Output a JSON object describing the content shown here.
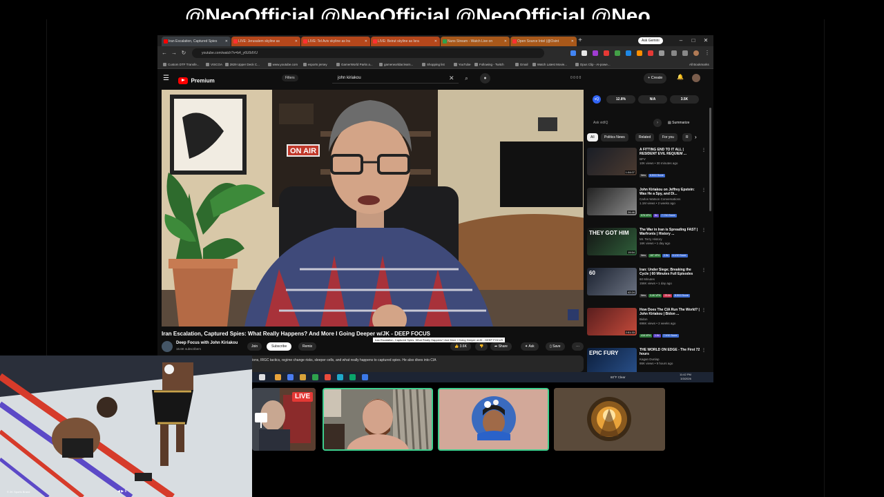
{
  "overlay": {
    "banner_text": "@NeoOfficial @NeoOfficial @NeoOfficial @Neo"
  },
  "browser": {
    "tabs": [
      {
        "label": "Iran Escalation, Captured Spies",
        "color": "#3b3f44",
        "active": true
      },
      {
        "label": "LIVE: Jerusalem skyline as",
        "color": "#b5471b"
      },
      {
        "label": "LIVE: Tel Aviv skyline as Ira",
        "color": "#b5471b"
      },
      {
        "label": "LIVE: Beirut skyline as Isra",
        "color": "#b5471b"
      },
      {
        "label": "Nuns Stream - Watch Live on",
        "color": "#a8581a"
      },
      {
        "label": "Open Source Intel (@Osint",
        "color": "#a8581a"
      }
    ],
    "new_tab": "+",
    "ask_gemini": "Ask Gemini",
    "window_controls": [
      "–",
      "□",
      "✕"
    ],
    "url": "youtube.com/watch?v=b4_y6U0dVU",
    "bookmarks": [
      "Custom DTF Transfe...",
      "VISCOA",
      "2829 Upper Deck C...",
      "www.youtube.com",
      "esports jersey",
      "GamerWorld Parks a...",
      "gamerworldar.learn...",
      "Shopping list",
      "YouTube",
      "Following - Twitch",
      "Gmail",
      "Watch Latest Movie...",
      "Opus Clip - AI-powe..."
    ],
    "all_bookmarks": "All Bookmarks"
  },
  "youtube": {
    "logo_word": "Premium",
    "filters": "Filters",
    "search_query": "john kiriakou",
    "header_stats": "0  0  0  0",
    "create": "+ Create",
    "video": {
      "on_air_sign": "ON AIR",
      "title": "Iran Escalation, Captured Spies: What Really Happens? And More I Going Deeper w/JK - DEEP FOCUS",
      "channel": "Deep Focus with John Kiriakou",
      "subscribers": "16.6K subscribers",
      "join": "Join",
      "subscribe": "Subscribe",
      "remix": "Remix",
      "tooltip": "Iran Escalation, Captured Spies: What Really Happens? And More I Going Deeper w/JK - DEEP FOCUS",
      "likes": "3.6K",
      "share": "Share",
      "ask": "Ask",
      "save": "Save",
      "more": "···",
      "description": "answers your top questions on escalating U.S.–Iran tensions, IRGC tactics, regime change risks, sleeper cells, and what really happens to captured spies. He also dives into CIA"
    },
    "sidebar": {
      "stats": [
        "12.8%",
        "N/A",
        "3.5K"
      ],
      "stats_logo": "vQ",
      "ask_placeholder": "Ask vidIQ",
      "summarize": "Summarize",
      "chips": [
        "All",
        "Politics News",
        "Related",
        "For you",
        "R"
      ],
      "recommendations": [
        {
          "title": "A FITTING END TO IT ALL | RESIDENT EVIL REQUIEM ...",
          "channel": "BFV",
          "meta": "10K views • 30 minutes ago",
          "badge_line": "New",
          "duration": "1:04:07",
          "thumb": [
            "#1a1e26",
            "#4b3a30"
          ],
          "badges": [
            {
              "t": "6.5/10 Score",
              "c": "#3d6bd1"
            }
          ]
        },
        {
          "title": "John Kiriakou on Jeffrey Epstein: Was He a Spy, and Di...",
          "channel": "Carlos Watson Conversations",
          "meta": "1.1M views • 2 weeks ago",
          "duration": "26:46",
          "thumb": [
            "#222",
            "#8a8a8a"
          ],
          "badges": [
            {
              "t": "578 VPH",
              "c": "#2f7a3b"
            },
            {
              "t": "8x",
              "c": "#5d45c9"
            },
            {
              "t": "7.7/10 Score",
              "c": "#3d6bd1"
            }
          ]
        },
        {
          "title": "The War in Iran is Spreading FAST | Warfronts | History ...",
          "channel": "Mr. Terry History",
          "meta": "16K views • 1 day ago",
          "badge_line": "New",
          "duration": "19:54",
          "thumb_text": "THEY GOT HIM",
          "thumb": [
            "#141414",
            "#2f5f3a"
          ],
          "badges": [
            {
              "t": "187 VPH",
              "c": "#2f7a3b"
            },
            {
              "t": "2.5x",
              "c": "#3d6bd1"
            },
            {
              "t": "6.1/10 Score",
              "c": "#3d6bd1"
            }
          ]
        },
        {
          "title": "Iran: Under Siege; Breaking the Cycle | 60 Minutes Full Episodes",
          "channel": "60 Minutes",
          "meta": "156K views • 1 day ago",
          "badge_line": "New",
          "duration": "42:24",
          "thumb_text": "60",
          "thumb": [
            "#1b2230",
            "#6a7180"
          ],
          "badges": [
            {
              "t": "3.4K VPH",
              "c": "#2f7a3b"
            },
            {
              "t": "23.4x",
              "c": "#c8344f"
            },
            {
              "t": "8.5/10 Score",
              "c": "#3d6bd1"
            }
          ]
        },
        {
          "title": "How Does The CIA Run The World? | John Kiriakou | Bidon ...",
          "channel": "Bidon",
          "meta": "696K views • 2 weeks ago",
          "duration": "2:51:33",
          "thumb": [
            "#5a1e1e",
            "#c44a3a"
          ],
          "badges": [
            {
              "t": "418 VPH",
              "c": "#2f7a3b"
            },
            {
              "t": "1.6x",
              "c": "#5d45c9"
            },
            {
              "t": "7.9/10 Score",
              "c": "#3d6bd1"
            }
          ]
        },
        {
          "title": "THE WORLD ON EDGE - The First 72 hours",
          "channel": "Kagan Dunlap",
          "meta": "86K views • 9 hours ago",
          "duration": "",
          "thumb_text": "EPIC FURY",
          "thumb": [
            "#0c1e3b",
            "#29508a"
          ],
          "badges": []
        }
      ]
    }
  },
  "taskbar": {
    "weather": "60°F  Clear",
    "time": "11:42 PM",
    "date": "3/3/2026"
  },
  "stream": {
    "live": "LIVE",
    "game_caption": "© 2K Sports Brand",
    "game_controls": "◀ ▶ II"
  },
  "colors": {
    "accent_red": "#ff0000",
    "speaking_border": "#3ecf8e",
    "live_badge": "#e53935"
  }
}
